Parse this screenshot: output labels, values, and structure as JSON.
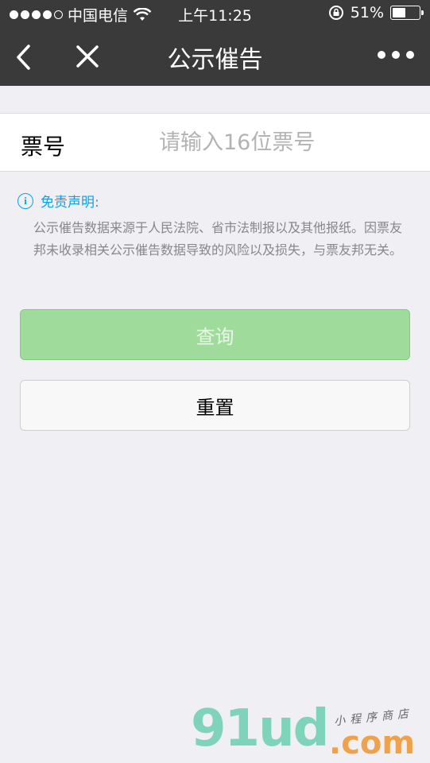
{
  "status_bar": {
    "carrier": "中国电信",
    "time": "上午11:25",
    "battery_percent": "51%",
    "battery_level": 0.51,
    "signal_bars": 4,
    "icons": [
      "signal-dots-icon",
      "wifi-icon",
      "rotation-lock-icon",
      "battery-icon"
    ]
  },
  "nav": {
    "title": "公示催告",
    "icons": [
      "back-arrow-icon",
      "close-icon",
      "more-dots-icon"
    ]
  },
  "form": {
    "label": "票号",
    "placeholder": "请输入16位票号",
    "value": ""
  },
  "disclaimer": {
    "title": "免责声明:",
    "text": "公示催告数据来源于人民法院、省市法制报以及其他报纸。因票友邦未收录相关公示催告数据导致的风险以及损失，与票友邦无关。",
    "icon": "info-icon"
  },
  "buttons": {
    "query": "查询",
    "reset": "重置"
  },
  "watermark": {
    "brand": "91ud",
    "suffix": ".com",
    "tagline": "小程序商店"
  },
  "colors": {
    "nav_bg": "#3a3a3a",
    "page_bg": "#efeff4",
    "accent_blue": "#10a0e6",
    "query_green": "#9fdc9b"
  }
}
